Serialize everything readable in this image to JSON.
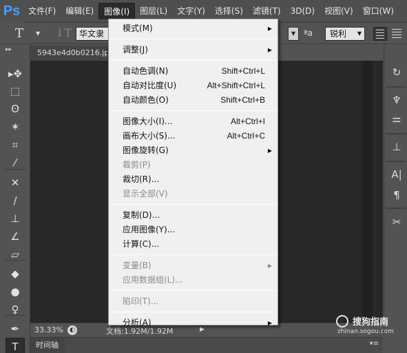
{
  "app": {
    "logo": "Ps"
  },
  "menubar": {
    "items": [
      "文件(F)",
      "编辑(E)",
      "图像(I)",
      "图层(L)",
      "文字(Y)",
      "选择(S)",
      "滤镜(T)",
      "3D(D)",
      "视图(V)",
      "窗口(W)"
    ],
    "active_index": 2
  },
  "options_bar": {
    "font_family": "华文隶书",
    "aa_glyph": "ªa",
    "antialias": "锐利"
  },
  "document": {
    "tab_title": "5943e4d0b0216.jpg",
    "zoom": "33.33%",
    "doc_info": "文档:1.92M/1.92M"
  },
  "timeline": {
    "label": "时间轴"
  },
  "image_menu": {
    "items": [
      {
        "label": "模式(M)",
        "shortcut": "",
        "submenu": true,
        "enabled": true
      },
      {
        "separator": true
      },
      {
        "label": "调整(J)",
        "shortcut": "",
        "submenu": true,
        "enabled": true
      },
      {
        "separator": true
      },
      {
        "label": "自动色调(N)",
        "shortcut": "Shift+Ctrl+L",
        "submenu": false,
        "enabled": true
      },
      {
        "label": "自动对比度(U)",
        "shortcut": "Alt+Shift+Ctrl+L",
        "submenu": false,
        "enabled": true
      },
      {
        "label": "自动颜色(O)",
        "shortcut": "Shift+Ctrl+B",
        "submenu": false,
        "enabled": true
      },
      {
        "separator": true
      },
      {
        "label": "图像大小(I)...",
        "shortcut": "Alt+Ctrl+I",
        "submenu": false,
        "enabled": true
      },
      {
        "label": "画布大小(S)...",
        "shortcut": "Alt+Ctrl+C",
        "submenu": false,
        "enabled": true
      },
      {
        "label": "图像旋转(G)",
        "shortcut": "",
        "submenu": true,
        "enabled": true
      },
      {
        "label": "裁剪(P)",
        "shortcut": "",
        "submenu": false,
        "enabled": false
      },
      {
        "label": "裁切(R)...",
        "shortcut": "",
        "submenu": false,
        "enabled": true
      },
      {
        "label": "显示全部(V)",
        "shortcut": "",
        "submenu": false,
        "enabled": false
      },
      {
        "separator": true
      },
      {
        "label": "复制(D)...",
        "shortcut": "",
        "submenu": false,
        "enabled": true
      },
      {
        "label": "应用图像(Y)...",
        "shortcut": "",
        "submenu": false,
        "enabled": true
      },
      {
        "label": "计算(C)...",
        "shortcut": "",
        "submenu": false,
        "enabled": true
      },
      {
        "separator": true
      },
      {
        "label": "变量(B)",
        "shortcut": "",
        "submenu": true,
        "enabled": false
      },
      {
        "label": "应用数据组(L)...",
        "shortcut": "",
        "submenu": false,
        "enabled": false
      },
      {
        "separator": true
      },
      {
        "label": "陷印(T)...",
        "shortcut": "",
        "submenu": false,
        "enabled": false
      },
      {
        "separator": true
      },
      {
        "label": "分析(A)",
        "shortcut": "",
        "submenu": true,
        "enabled": true
      }
    ]
  },
  "left_tools": [
    {
      "name": "move-tool-icon",
      "glyph": "▸✥"
    },
    {
      "name": "marquee-tool-icon",
      "glyph": "⬚"
    },
    {
      "name": "lasso-tool-icon",
      "glyph": "ʘ"
    },
    {
      "name": "magic-wand-tool-icon",
      "glyph": "✶"
    },
    {
      "name": "crop-tool-icon",
      "glyph": "⌗"
    },
    {
      "name": "eyedropper-tool-icon",
      "glyph": "⁄"
    },
    {
      "name": "healing-brush-tool-icon",
      "glyph": "✕"
    },
    {
      "name": "brush-tool-icon",
      "glyph": "∕"
    },
    {
      "name": "clone-stamp-tool-icon",
      "glyph": "⊥"
    },
    {
      "name": "history-brush-tool-icon",
      "glyph": "∠"
    },
    {
      "name": "eraser-tool-icon",
      "glyph": "▱"
    },
    {
      "name": "paint-bucket-tool-icon",
      "glyph": "◆"
    },
    {
      "name": "blur-tool-icon",
      "glyph": "●"
    },
    {
      "name": "dodge-tool-icon",
      "glyph": "♀"
    },
    {
      "name": "pen-tool-icon",
      "glyph": "✒"
    },
    {
      "name": "type-tool-icon",
      "glyph": "T"
    }
  ],
  "dock_buttons": [
    {
      "name": "history-panel-icon",
      "glyph": "↻"
    },
    {
      "name": "brush-panel-icon",
      "glyph": "♆"
    },
    {
      "name": "adjustments-panel-icon",
      "glyph": "⚌"
    },
    {
      "name": "clone-source-panel-icon",
      "glyph": "⊥"
    },
    {
      "name": "character-panel-icon",
      "glyph": "A|"
    },
    {
      "name": "paragraph-panel-icon",
      "glyph": "¶"
    },
    {
      "name": "tools-presets-panel-icon",
      "glyph": "✂"
    }
  ],
  "watermark": {
    "brand": "搜狗指南",
    "url": "zhinan.sogou.com"
  }
}
